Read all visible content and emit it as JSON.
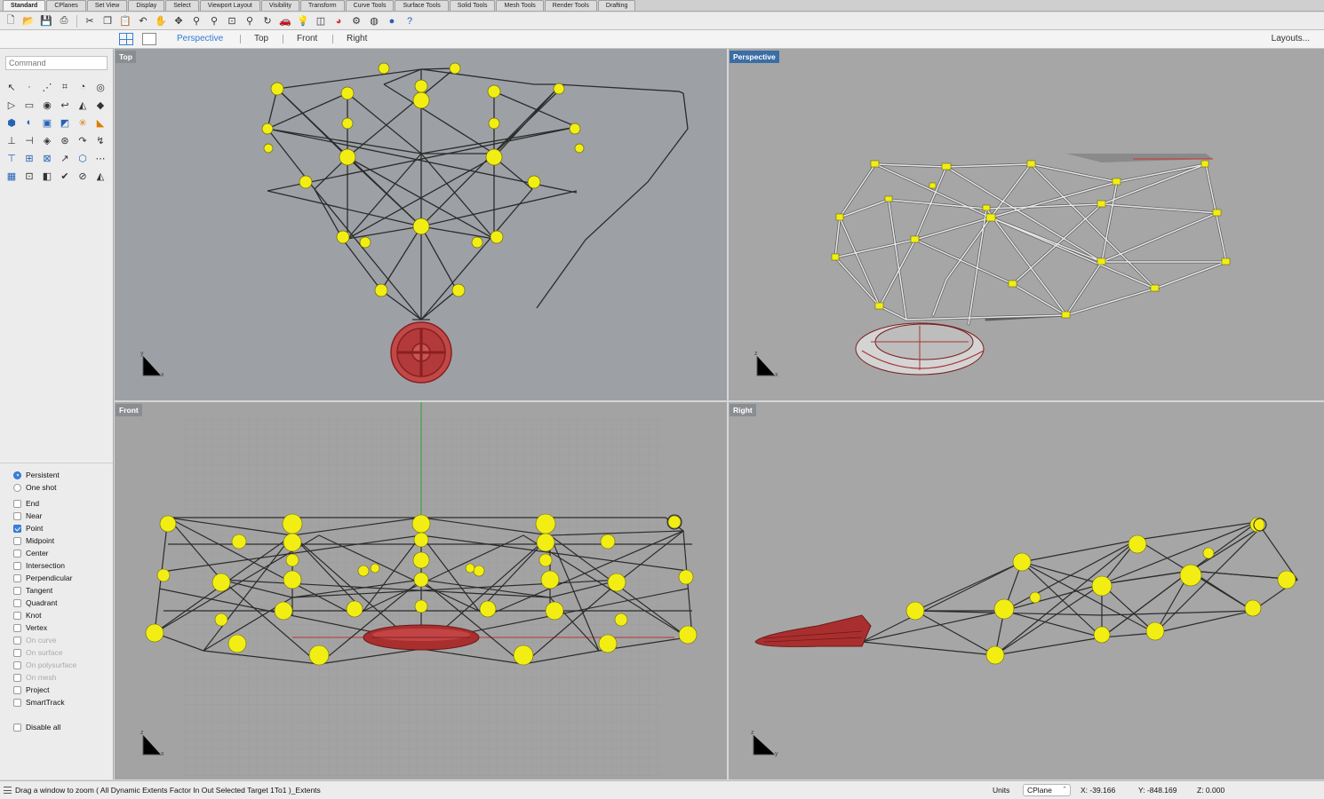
{
  "tabs": [
    "Standard",
    "CPlanes",
    "Set View",
    "Display",
    "Select",
    "Viewport Layout",
    "Visibility",
    "Transform",
    "Curve Tools",
    "Surface Tools",
    "Solid Tools",
    "Mesh Tools",
    "Render Tools",
    "Drafting"
  ],
  "toolbar_icons": [
    "new-file-icon",
    "open-folder-icon",
    "save-icon",
    "print-icon",
    "cut-icon",
    "copy-icon",
    "paste-icon",
    "undo-icon",
    "pan-icon",
    "rotate-icon",
    "zoom-icon",
    "zoom-extents-icon",
    "zoom-window-icon",
    "zoom-selected-icon",
    "named-views-icon",
    "car-icon",
    "lightbulb-icon",
    "layer-icon",
    "color-wheel-icon",
    "properties-icon",
    "render-icon",
    "sphere-icon",
    "help-icon"
  ],
  "viewtabs": {
    "perspective": "Perspective",
    "top": "Top",
    "front": "Front",
    "right": "Right",
    "layouts": "Layouts..."
  },
  "command": {
    "placeholder": "Command"
  },
  "tools": [
    "↖",
    "·",
    "⋰",
    "⌗",
    "◔",
    "◎",
    "▷",
    "▭",
    "◉",
    "↩",
    "◭",
    "◆",
    "⬢",
    "◐",
    "▣",
    "◩",
    "✳",
    "◣",
    "⊥",
    "⊣",
    "◈",
    "⊛",
    "↷",
    "↯",
    "⊤",
    "⊞",
    "⊠",
    "↗",
    "⬡",
    "⋯",
    "▦",
    "⊡",
    "◧",
    "✔",
    "⊘",
    "◭"
  ],
  "osnap": {
    "persistent": "Persistent",
    "oneshot": "One shot",
    "items": [
      {
        "label": "End",
        "checked": false,
        "enabled": true
      },
      {
        "label": "Near",
        "checked": false,
        "enabled": true
      },
      {
        "label": "Point",
        "checked": true,
        "enabled": true
      },
      {
        "label": "Midpoint",
        "checked": false,
        "enabled": true
      },
      {
        "label": "Center",
        "checked": false,
        "enabled": true
      },
      {
        "label": "Intersection",
        "checked": false,
        "enabled": true
      },
      {
        "label": "Perpendicular",
        "checked": false,
        "enabled": true
      },
      {
        "label": "Tangent",
        "checked": false,
        "enabled": true
      },
      {
        "label": "Quadrant",
        "checked": false,
        "enabled": true
      },
      {
        "label": "Knot",
        "checked": false,
        "enabled": true
      },
      {
        "label": "Vertex",
        "checked": false,
        "enabled": true
      },
      {
        "label": "On curve",
        "checked": false,
        "enabled": false
      },
      {
        "label": "On surface",
        "checked": false,
        "enabled": false
      },
      {
        "label": "On polysurface",
        "checked": false,
        "enabled": false
      },
      {
        "label": "On mesh",
        "checked": false,
        "enabled": false
      },
      {
        "label": "Project",
        "checked": false,
        "enabled": true
      },
      {
        "label": "SmartTrack",
        "checked": false,
        "enabled": true
      }
    ],
    "disable_all": "Disable all"
  },
  "viewports": {
    "top": "Top",
    "perspective": "Perspective",
    "front": "Front",
    "right": "Right"
  },
  "colors": {
    "node": "#f2ee14",
    "wheel": "#b43434",
    "accent": "#2f7bd6"
  },
  "status": {
    "prompt": "Drag a window to zoom ( All Dynamic Extents Factor In Out Selected Target 1To1 )_Extents",
    "units_label": "Units",
    "cplane": "CPlane",
    "x": "X: -39.166",
    "y": "Y: -848.169",
    "z": "Z: 0.000"
  }
}
